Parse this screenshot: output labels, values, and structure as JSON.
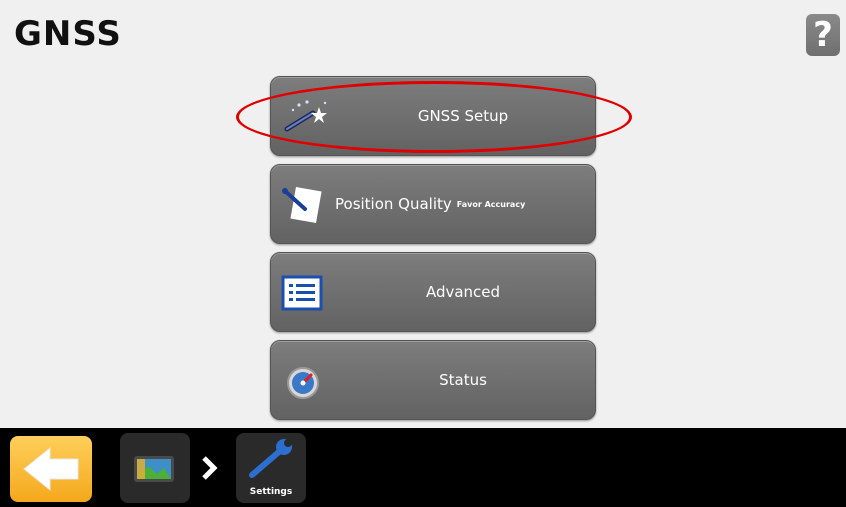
{
  "header": {
    "title": "GNSS",
    "help_label": "?"
  },
  "menu": {
    "items": [
      {
        "label": "GNSS Setup",
        "icon": "setup-wand-icon"
      },
      {
        "label": "Position Quality",
        "sublabel": "Favor Accuracy",
        "icon": "position-quality-icon"
      },
      {
        "label": "Advanced",
        "icon": "advanced-list-icon"
      },
      {
        "label": "Status",
        "icon": "status-gauge-icon"
      }
    ]
  },
  "bottom_bar": {
    "back_icon": "back-arrow-icon",
    "breadcrumb": {
      "home_icon": "home-screen-icon",
      "separator_icon": "chevron-right-icon",
      "current_label": "Settings",
      "current_icon": "wrench-icon"
    }
  },
  "annotation": {
    "highlight_color": "#e00000"
  },
  "colors": {
    "background": "#f0f0f0",
    "button": "#707070",
    "back_button": "#f4a81c",
    "bar": "#000000"
  }
}
